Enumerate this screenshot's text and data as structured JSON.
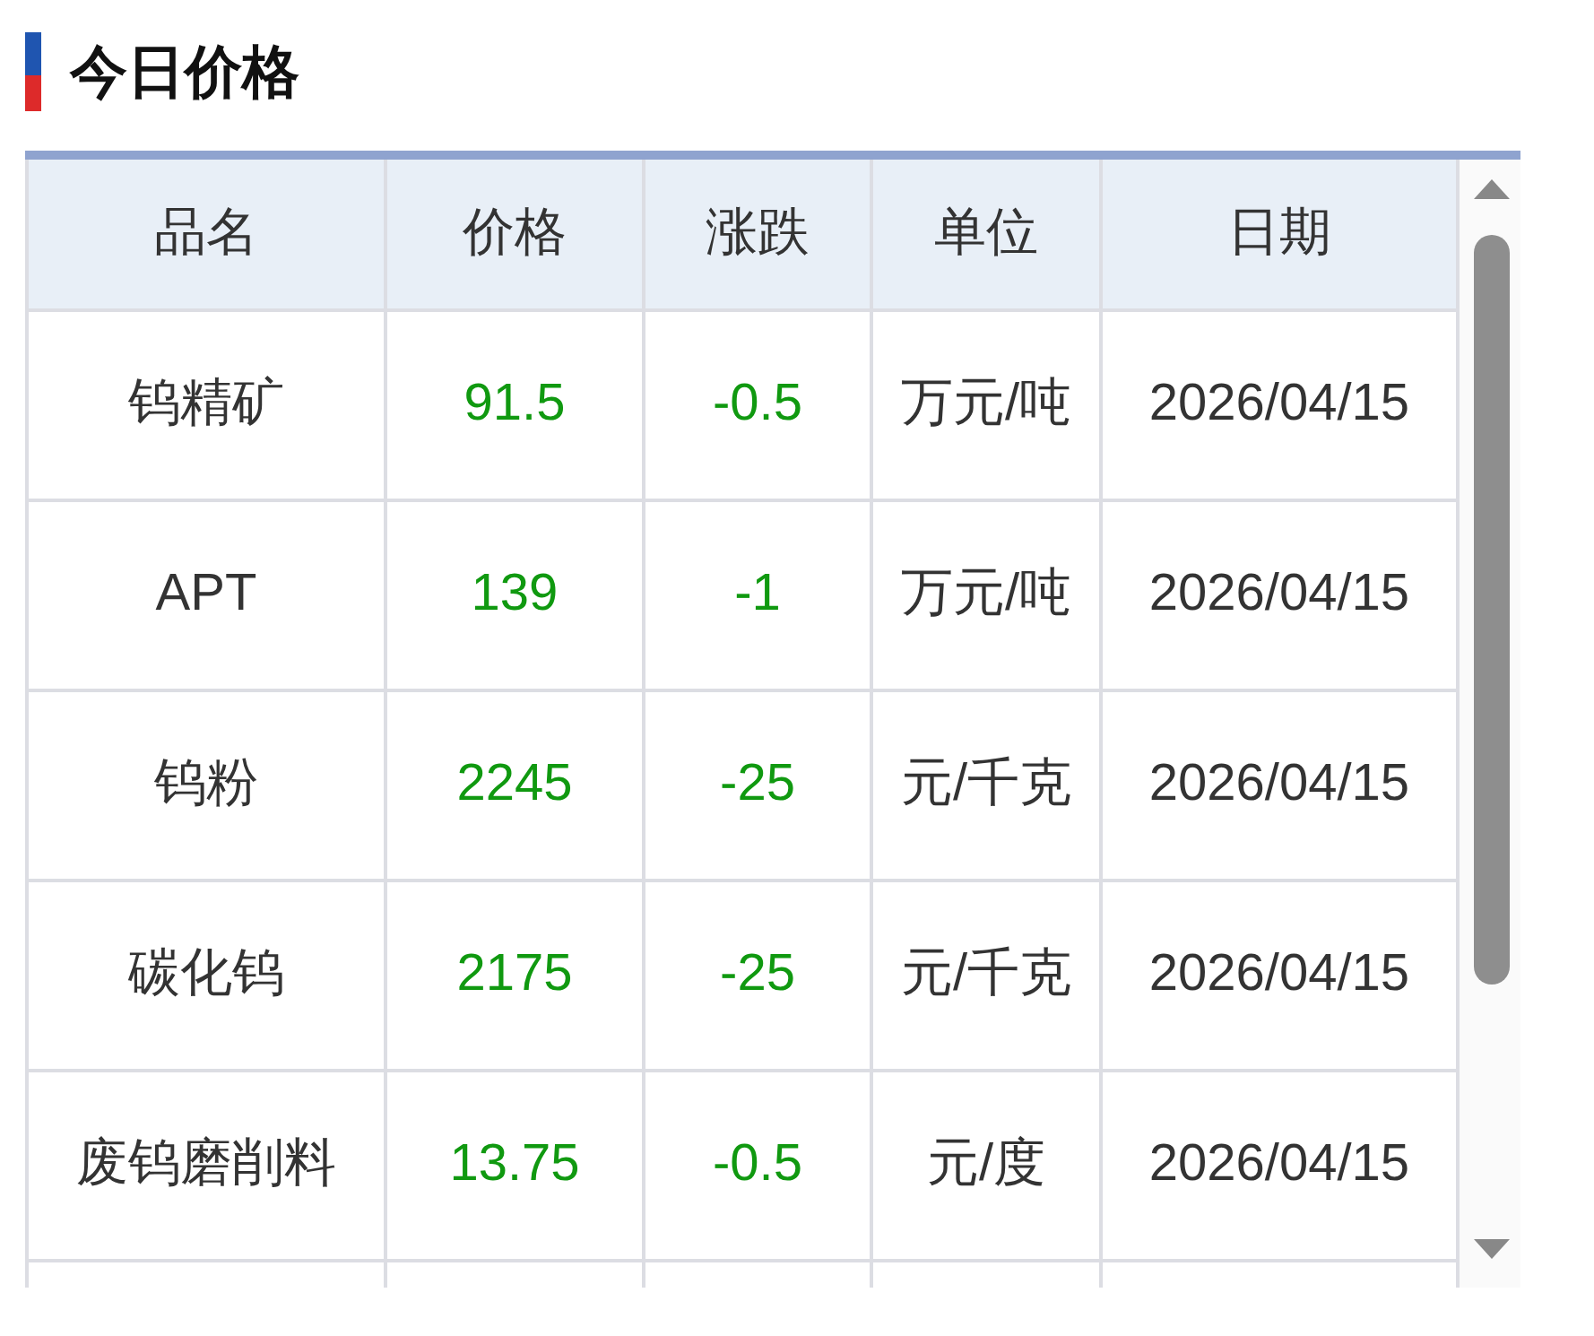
{
  "title": "今日价格",
  "table": {
    "columns": [
      "品名",
      "价格",
      "涨跌",
      "单位",
      "日期"
    ],
    "rows": [
      {
        "name": "钨精矿",
        "price": "91.5",
        "change": "-0.5",
        "unit": "万元/吨",
        "date": "2026/04/15",
        "color": "#109910"
      },
      {
        "name": "APT",
        "price": "139",
        "change": "-1",
        "unit": "万元/吨",
        "date": "2026/04/15",
        "color": "#109910"
      },
      {
        "name": "钨粉",
        "price": "2245",
        "change": "-25",
        "unit": "元/千克",
        "date": "2026/04/15",
        "color": "#109910"
      },
      {
        "name": "碳化钨",
        "price": "2175",
        "change": "-25",
        "unit": "元/千克",
        "date": "2026/04/15",
        "color": "#109910"
      },
      {
        "name": "废钨磨削料",
        "price": "13.75",
        "change": "-0.5",
        "unit": "元/度",
        "date": "2026/04/15",
        "color": "#109910"
      }
    ]
  }
}
